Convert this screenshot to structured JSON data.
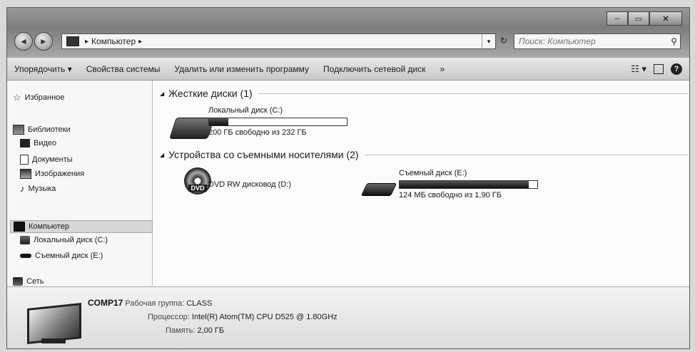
{
  "window_controls": {
    "minimize": "–",
    "maximize": "▭",
    "close": "✕"
  },
  "nav": {
    "back": "◄",
    "forward": "►"
  },
  "address": {
    "crumbs": [
      "Компьютер"
    ]
  },
  "search": {
    "placeholder": "Поиск: Компьютер"
  },
  "toolbar": {
    "organize": "Упорядочить ▾",
    "system_properties": "Свойства системы",
    "uninstall": "Удалить или изменить программу",
    "map_drive": "Подключить сетевой диск",
    "more": "»"
  },
  "sidebar": {
    "favorites": "Избранное",
    "libraries": "Библиотеки",
    "video": "Видео",
    "documents": "Документы",
    "images": "Изображения",
    "music": "Музыка",
    "computer": "Компьютер",
    "local_disk": "Локальный диск (C:)",
    "removable": "Съемный диск (E:)",
    "network": "Сеть"
  },
  "groups": {
    "hard_disks": "Жесткие диски (1)",
    "removable": "Устройства со съемными носителями (2)"
  },
  "drives": {
    "c": {
      "name": "Локальный диск (C:)",
      "free_text": "200 ГБ свободно из 232 ГБ",
      "used_fraction": 0.14
    },
    "dvd": {
      "name": "DVD RW дисковод (D:)",
      "label": "DVD"
    },
    "e": {
      "name": "Съемный диск (E:)",
      "free_text": "124 МБ свободно из 1,90 ГБ",
      "used_fraction": 0.94
    }
  },
  "details": {
    "computer_name": "COMP17",
    "workgroup_label": "Рабочая группа:",
    "workgroup": "CLASS",
    "processor_label": "Процессор:",
    "processor": "Intel(R) Atom(TM) CPU D525  @ 1.80GHz",
    "memory_label": "Память:",
    "memory": "2,00 ГБ"
  }
}
